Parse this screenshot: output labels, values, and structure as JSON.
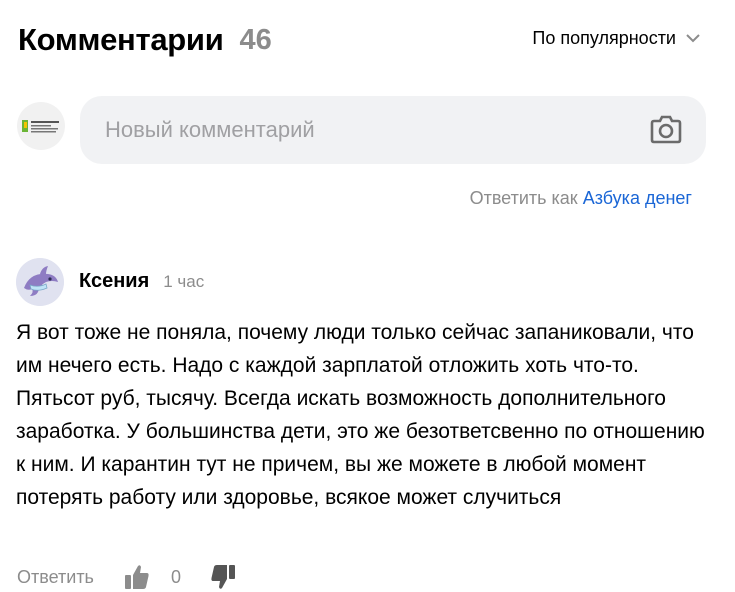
{
  "header": {
    "title": "Комментарии",
    "count": "46",
    "sort_label": "По популярности"
  },
  "composer": {
    "avatar_text": "АЗБУКА ДЕНЕГ от АЛЕКСАНДРА ЯКОВЕНКОВА",
    "placeholder": "Новый комментарий",
    "camera_icon": "camera-icon"
  },
  "reply_as": {
    "prefix": "Ответить как",
    "name": "Азбука денег"
  },
  "comment": {
    "author": "Ксения",
    "time": "1 час",
    "text": "Я вот тоже не поняла, почему люди только сейчас запаниковали, что им нечего есть. Надо с каждой зарплатой отложить хоть что-то. Пятьсот руб, тысячу. Всегда искать возможность дополнительного заработка. У большинства дети, это же безответсвенно по отношению к ним. И карантин тут не причем, вы же можете в любой момент потерять работу или здоровье, всякое может случиться",
    "reply_label": "Ответить",
    "votes": "0"
  },
  "colors": {
    "muted": "#8c8c8c",
    "link": "#1a66d6",
    "input_bg": "#f1f2f4"
  }
}
